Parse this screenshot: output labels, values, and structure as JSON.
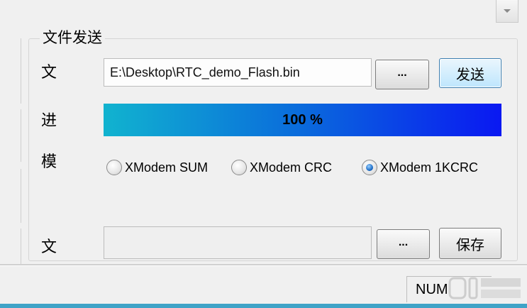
{
  "group": {
    "title": "文件发送"
  },
  "rows": {
    "file": {
      "label": "文",
      "path_value": "E:\\Desktop\\RTC_demo_Flash.bin",
      "browse_label": "...",
      "send_label": "发送"
    },
    "progress": {
      "label": "进",
      "percent": 100,
      "text": "100 %",
      "colors": {
        "start": "#11b3cf",
        "mid": "#0a6adc",
        "end": "#0a18f2"
      }
    },
    "mode": {
      "label": "模",
      "options": [
        {
          "label": "XModem SUM",
          "checked": false
        },
        {
          "label": "XModem CRC",
          "checked": false
        },
        {
          "label": "XModem 1KCRC",
          "checked": true
        }
      ]
    },
    "save": {
      "label": "文",
      "path_value": "",
      "browse_label": "...",
      "save_label": "保存"
    }
  },
  "status_bar": {
    "num_indicator": "NUM"
  },
  "icons": {
    "dropdown": "chevron-down-icon",
    "watermark": "watermark-logo"
  },
  "colors": {
    "accent": "#3fa3c7",
    "send_border": "#3c7fb1"
  }
}
